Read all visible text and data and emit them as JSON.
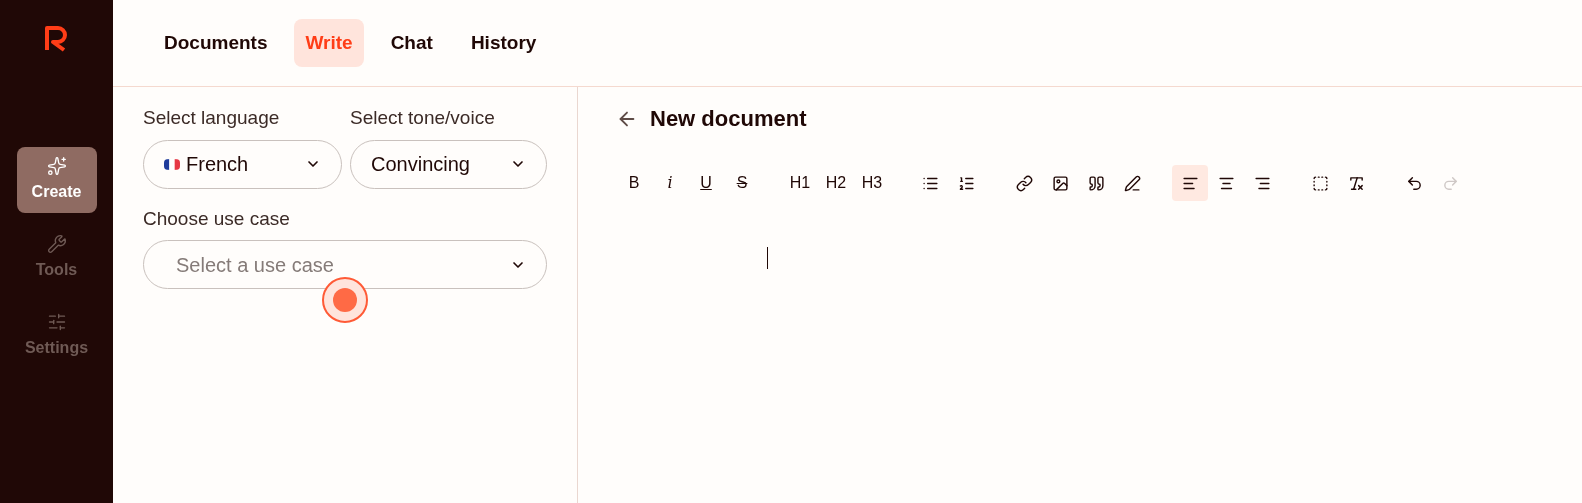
{
  "sidebar": {
    "items": [
      {
        "kind": "create",
        "label": "Create",
        "selected": true
      },
      {
        "kind": "tools",
        "label": "Tools",
        "selected": false
      },
      {
        "kind": "settings",
        "label": "Settings",
        "selected": false
      }
    ]
  },
  "tabs": [
    {
      "label": "Documents",
      "selected": false
    },
    {
      "label": "Write",
      "selected": true
    },
    {
      "label": "Chat",
      "selected": false
    },
    {
      "label": "History",
      "selected": false
    }
  ],
  "form": {
    "language": {
      "label": "Select language",
      "value": "French"
    },
    "tone": {
      "label": "Select tone/voice",
      "value": "Convincing"
    },
    "use_case": {
      "label": "Choose use case",
      "placeholder": "Select a use case"
    }
  },
  "editor": {
    "title": "New document",
    "toolbar": [
      [
        {
          "kind": "bold",
          "label": "B",
          "selected": false,
          "disabled": false
        },
        {
          "kind": "italic",
          "label": "i",
          "selected": false,
          "disabled": false
        },
        {
          "kind": "underline",
          "label": "U",
          "selected": false,
          "disabled": false
        },
        {
          "kind": "strike",
          "label": "S",
          "selected": false,
          "disabled": false
        }
      ],
      [
        {
          "kind": "heading",
          "label": "H1",
          "selected": false,
          "disabled": false
        },
        {
          "kind": "heading",
          "label": "H2",
          "selected": false,
          "disabled": false
        },
        {
          "kind": "heading",
          "label": "H3",
          "selected": false,
          "disabled": false
        }
      ],
      [
        {
          "kind": "bullet-list",
          "selected": false,
          "disabled": false
        },
        {
          "kind": "numbered-list",
          "selected": false,
          "disabled": false
        }
      ],
      [
        {
          "kind": "link",
          "selected": false,
          "disabled": false
        },
        {
          "kind": "image",
          "selected": false,
          "disabled": false
        },
        {
          "kind": "quote",
          "selected": false,
          "disabled": false
        },
        {
          "kind": "highlight",
          "selected": false,
          "disabled": false
        }
      ],
      [
        {
          "kind": "align-left",
          "selected": true,
          "disabled": false
        },
        {
          "kind": "align-center",
          "selected": false,
          "disabled": false
        },
        {
          "kind": "align-right",
          "selected": false,
          "disabled": false
        }
      ],
      [
        {
          "kind": "select-all",
          "selected": false,
          "disabled": false
        },
        {
          "kind": "clear-format",
          "selected": false,
          "disabled": false
        }
      ],
      [
        {
          "kind": "undo",
          "selected": false,
          "disabled": false
        },
        {
          "kind": "redo",
          "selected": false,
          "disabled": true
        }
      ]
    ]
  }
}
